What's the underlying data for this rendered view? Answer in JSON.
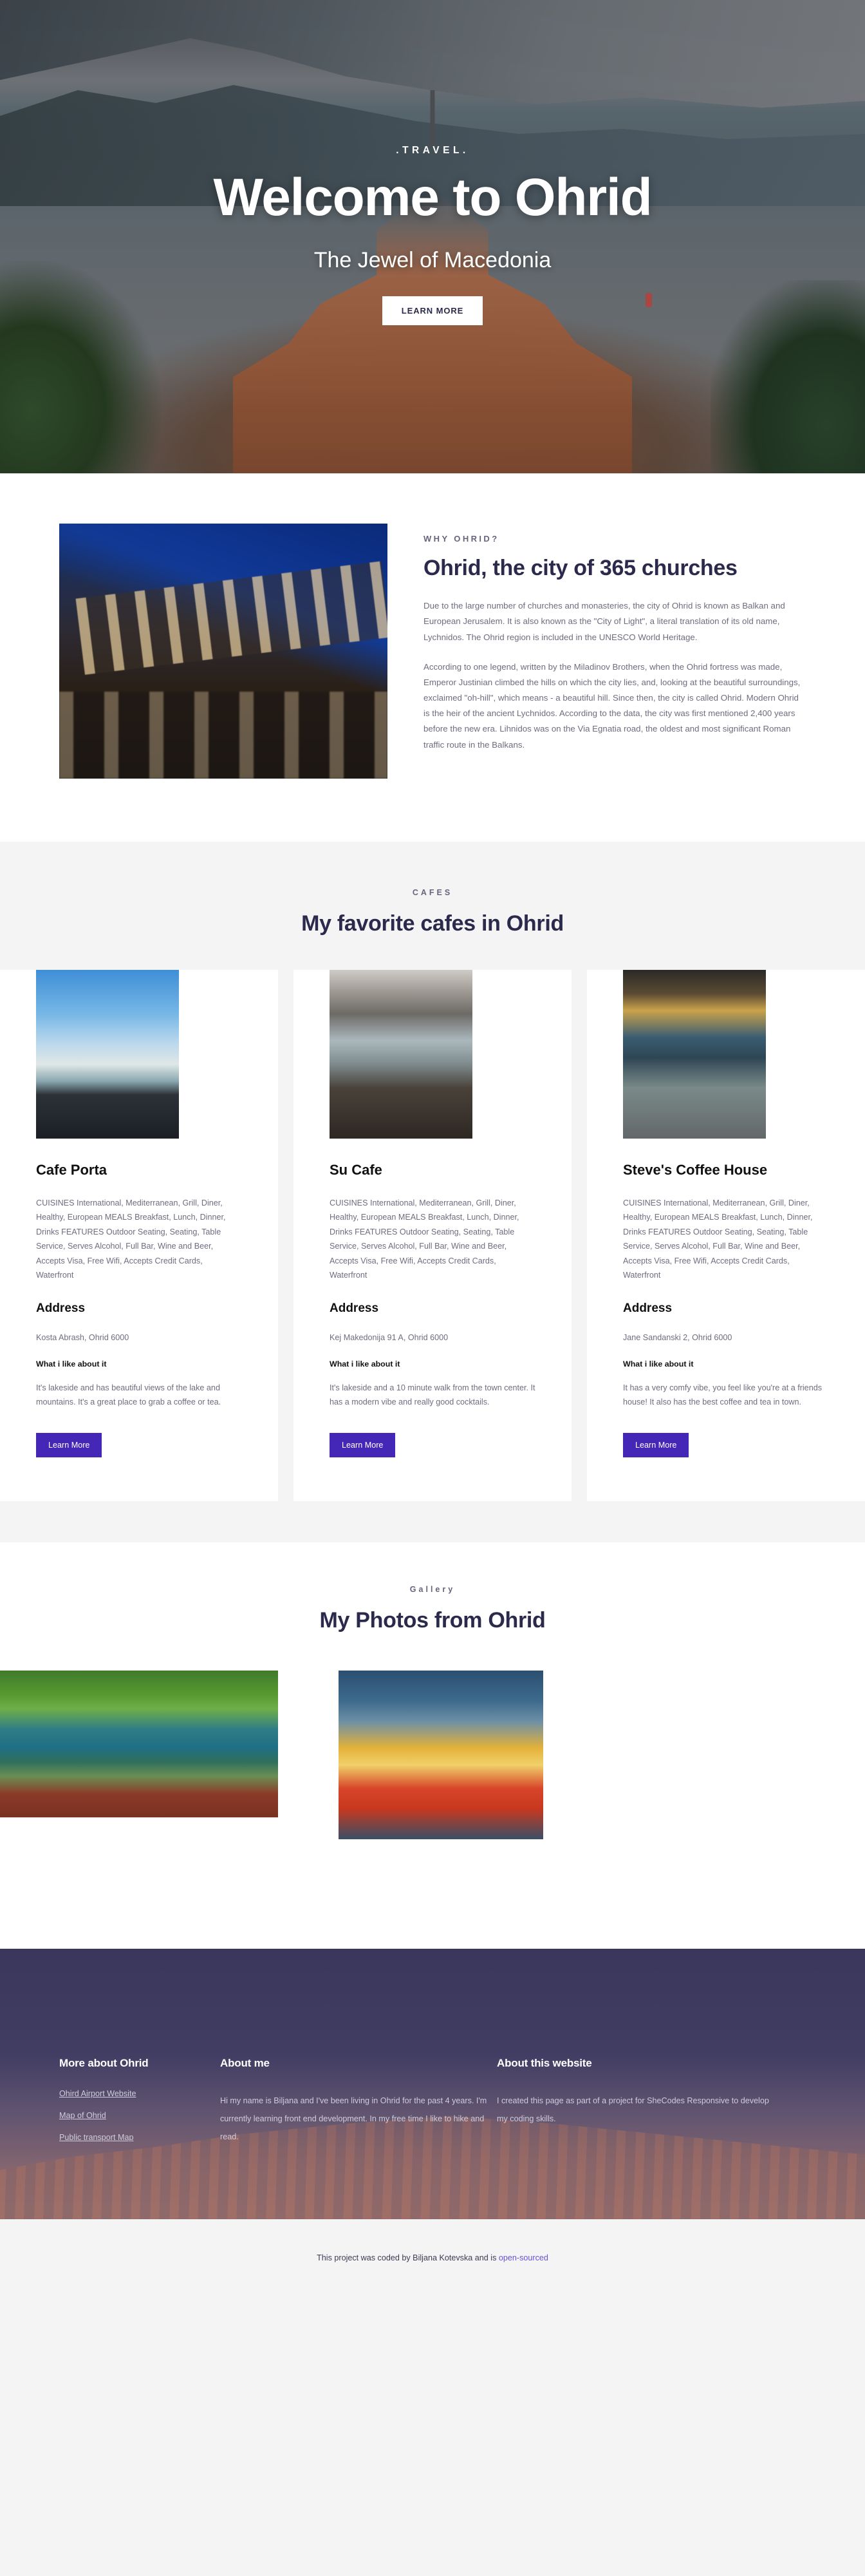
{
  "hero": {
    "eyebrow": ".TRAVEL.",
    "title": "Welcome to Ohrid",
    "subtitle": "The Jewel of Macedonia",
    "button": "LEARN MORE"
  },
  "why": {
    "eyebrow": "WHY OHRID?",
    "heading": "Ohrid, the city of 365 churches",
    "paragraph_1": "Due to the large number of churches and monasteries, the city of Ohrid is known as Balkan and European Jerusalem. It is also known as the \"City of Light\", a literal translation of its old name, Lychnidos. The Ohrid region is included in the UNESCO World Heritage.",
    "paragraph_2": "According to one legend, written by the Miladinov Brothers, when the Ohrid fortress was made, Emperor Justinian climbed the hills on which the city lies, and, looking at the beautiful surroundings, exclaimed \"oh-hill\", which means - a beautiful hill. Since then, the city is called Ohrid. Modern Ohrid is the heir of the ancient Lychnidos. According to the data, the city was first mentioned 2,400 years before the new era. Lihnidos was on the Via Egnatia road, the oldest and most significant Roman traffic route in the Balkans."
  },
  "cafes": {
    "eyebrow": "CAFES",
    "heading": "My favorite cafes in Ohrid",
    "address_label": "Address",
    "like_label": "What i like about it",
    "button": "Learn More",
    "items": [
      {
        "name": "Cafe Porta",
        "description": "CUISINES International, Mediterranean, Grill, Diner, Healthy, European MEALS Breakfast, Lunch, Dinner, Drinks FEATURES Outdoor Seating, Seating, Table Service, Serves Alcohol, Full Bar, Wine and Beer, Accepts Visa, Free Wifi, Accepts Credit Cards, Waterfront",
        "address": "Kosta Abrash, Ohrid 6000",
        "like": "It's lakeside and has beautiful views of the lake and mountains. It's a great place to grab a coffee or tea."
      },
      {
        "name": "Su Cafe",
        "description": "CUISINES International, Mediterranean, Grill, Diner, Healthy, European MEALS Breakfast, Lunch, Dinner, Drinks FEATURES Outdoor Seating, Seating, Table Service, Serves Alcohol, Full Bar, Wine and Beer, Accepts Visa, Free Wifi, Accepts Credit Cards, Waterfront",
        "address": "Kej Makedonija 91 A, Ohrid 6000",
        "like": "It's lakeside and a 10 minute walk from the town center. It has a modern vibe and really good cocktails."
      },
      {
        "name": "Steve's Coffee House",
        "description": "CUISINES International, Mediterranean, Grill, Diner, Healthy, European MEALS Breakfast, Lunch, Dinner, Drinks FEATURES Outdoor Seating, Seating, Table Service, Serves Alcohol, Full Bar, Wine and Beer, Accepts Visa, Free Wifi, Accepts Credit Cards, Waterfront",
        "address": "Jane Sandanski 2, Ohrid 6000",
        "like": "It has a very comfy vibe, you feel like you're at a friends house! It also has the best coffee and tea in town."
      }
    ]
  },
  "gallery": {
    "eyebrow": "Gallery",
    "heading": "My Photos from Ohrid"
  },
  "footer": {
    "col1_heading": "More about Ohrid",
    "links": [
      "Ohird Airport Website",
      "Map of Ohrid",
      "Public transport Map"
    ],
    "col2_heading": "About me",
    "col2_text": "Hi my name is Biljana and I've been living in Ohrid for the past 4 years. I'm currently learning front end development. In my free time I like to hike and read.",
    "col3_heading": "About this website",
    "col3_text": "I created this page as part of a project for SheCodes Responsive to develop my coding skills."
  },
  "copyright": {
    "text": "This project was coded by Biljana Kotevska and is ",
    "link": "open-sourced"
  },
  "colors": {
    "accent_purple": "#4527b8",
    "dark_navy": "#2b2a4c",
    "page_bg": "#f4f4f5",
    "link_purple": "#6a4fd8"
  }
}
